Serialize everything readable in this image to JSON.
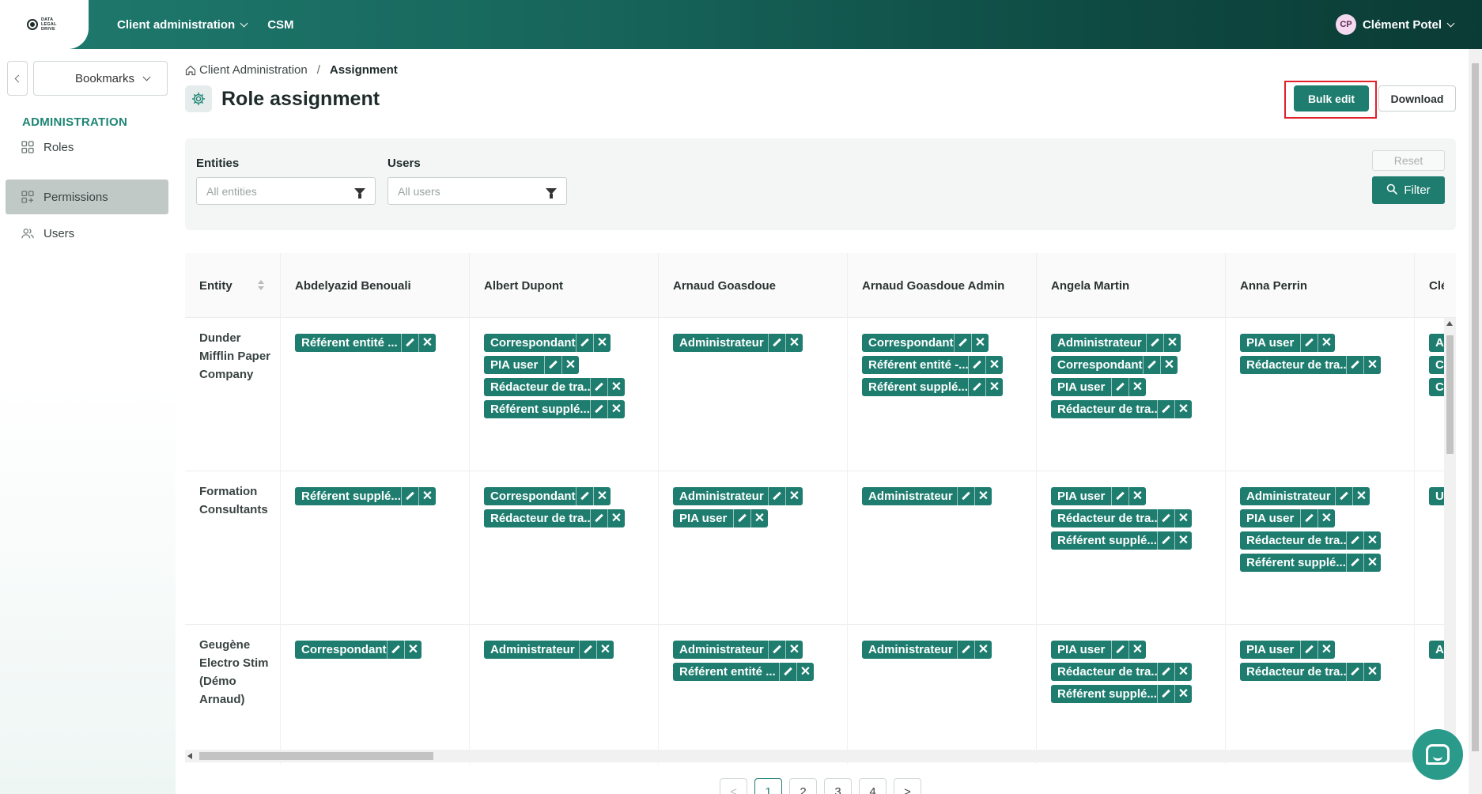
{
  "topbar": {
    "logo_text": "DATA LEGAL DRIVE",
    "nav": [
      {
        "label": "Client administration",
        "has_dropdown": true
      },
      {
        "label": "CSM",
        "has_dropdown": false
      }
    ],
    "user_initials": "CP",
    "user_name": "Clément Potel"
  },
  "sidebar": {
    "bookmarks_label": "Bookmarks",
    "section_title": "ADMINISTRATION",
    "items": [
      {
        "label": "Roles",
        "icon": "grid-icon",
        "active": false
      },
      {
        "label": "Permissions",
        "icon": "grid-plus-icon",
        "active": true
      },
      {
        "label": "Users",
        "icon": "users-icon",
        "active": false
      }
    ]
  },
  "breadcrumb": {
    "home": "Client Administration",
    "separator": "/",
    "current": "Assignment"
  },
  "page": {
    "title": "Role assignment",
    "bulk_edit_label": "Bulk edit",
    "download_label": "Download"
  },
  "filters": {
    "entities_label": "Entities",
    "entities_placeholder": "All entities",
    "users_label": "Users",
    "users_placeholder": "All users",
    "reset_label": "Reset",
    "filter_label": "Filter"
  },
  "table": {
    "entity_header": "Entity",
    "columns": [
      "Abdelyazid Benouali",
      "Albert Dupont",
      "Arnaud Goasdoue",
      "Arnaud Goasdoue Admin",
      "Angela Martin",
      "Anna Perrin",
      "Clém"
    ],
    "rows": [
      {
        "entity": "Dunder Mifflin Paper Company",
        "cells": [
          [
            "Référent entité ..."
          ],
          [
            "Correspondant",
            "PIA user",
            "Rédacteur de tra...",
            "Référent supplé..."
          ],
          [
            "Administrateur"
          ],
          [
            "Correspondant",
            "Référent entité -...",
            "Référent supplé..."
          ],
          [
            "Administrateur",
            "Correspondant",
            "PIA user",
            "Rédacteur de tra..."
          ],
          [
            "PIA user",
            "Rédacteur de tra..."
          ],
          [
            "Ac",
            "Co",
            "Co"
          ]
        ]
      },
      {
        "entity": "Formation Consultants",
        "cells": [
          [
            "Référent supplé..."
          ],
          [
            "Correspondant",
            "Rédacteur de tra..."
          ],
          [
            "Administrateur",
            "PIA user"
          ],
          [
            "Administrateur"
          ],
          [
            "PIA user",
            "Rédacteur de tra...",
            "Référent supplé..."
          ],
          [
            "Administrateur",
            "PIA user",
            "Rédacteur de tra...",
            "Référent supplé..."
          ],
          [
            "U"
          ]
        ]
      },
      {
        "entity": "Geugène Electro Stim (Démo Arnaud)",
        "cells": [
          [
            "Correspondant"
          ],
          [
            "Administrateur"
          ],
          [
            "Administrateur",
            "Référent entité ..."
          ],
          [
            "Administrateur"
          ],
          [
            "PIA user",
            "Rédacteur de tra...",
            "Référent supplé..."
          ],
          [
            "PIA user",
            "Rédacteur de tra..."
          ],
          [
            "Ac"
          ]
        ]
      }
    ]
  },
  "pagination": {
    "prev": "<",
    "pages": [
      "1",
      "2",
      "3",
      "4"
    ],
    "current": "1",
    "next": ">"
  },
  "colors": {
    "primary": "#1e7d6f",
    "highlight_outline": "#e0202a"
  }
}
